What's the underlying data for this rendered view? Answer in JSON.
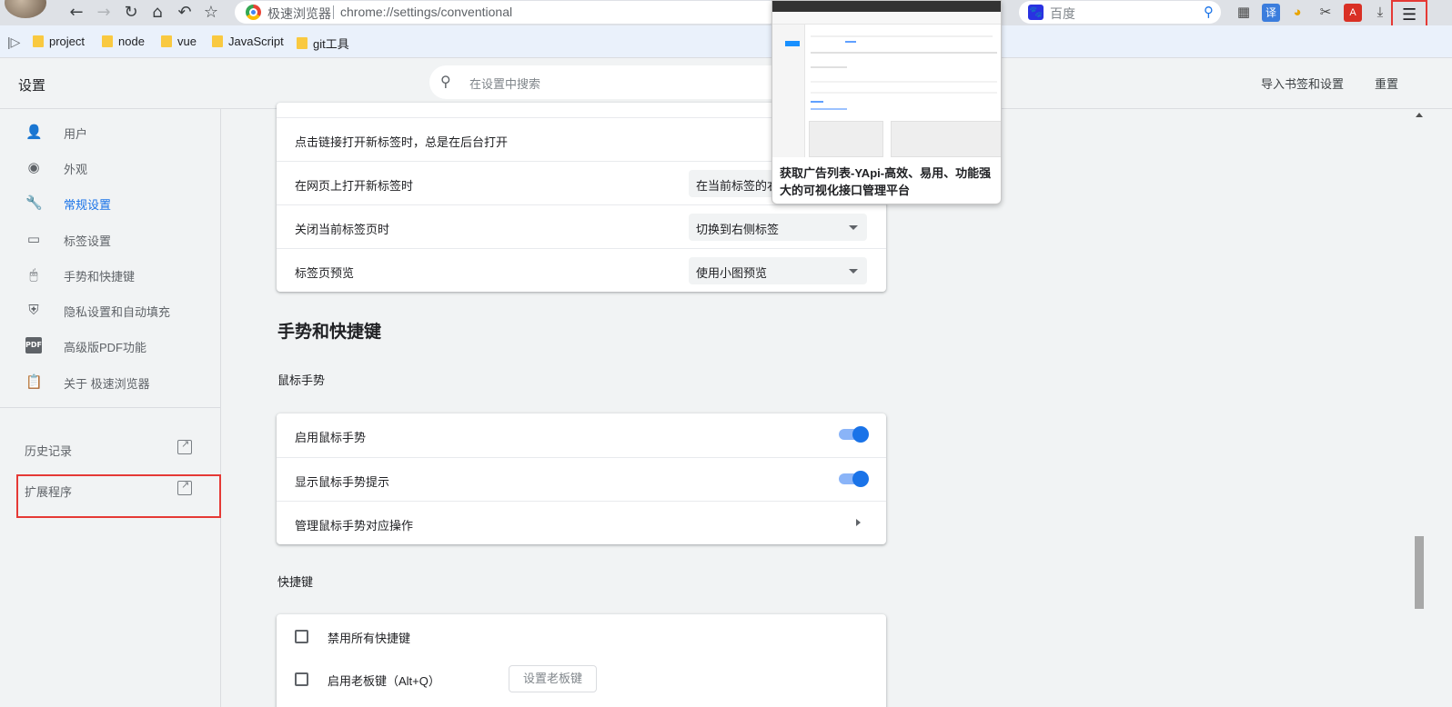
{
  "browser": {
    "name": "极速浏览器",
    "url": "chrome://settings/conventional",
    "search_placeholder": "百度",
    "bookmarks": [
      "project",
      "node",
      "vue",
      "JavaScript",
      "git工具"
    ]
  },
  "settings": {
    "title": "设置",
    "search_placeholder": "在设置中搜索",
    "import_label": "导入书签和设置",
    "reset_label": "重置"
  },
  "sidebar": {
    "items": [
      {
        "label": "用户",
        "icon": "person-icon"
      },
      {
        "label": "外观",
        "icon": "palette-icon"
      },
      {
        "label": "常规设置",
        "icon": "wrench-icon"
      },
      {
        "label": "标签设置",
        "icon": "tab-icon"
      },
      {
        "label": "手势和快捷键",
        "icon": "mouse-icon"
      },
      {
        "label": "隐私设置和自动填充",
        "icon": "shield-icon"
      },
      {
        "label": "高级版PDF功能",
        "icon": "pdf-icon"
      },
      {
        "label": "关于 极速浏览器",
        "icon": "clipboard-icon"
      }
    ],
    "active_index": 2,
    "links": [
      {
        "label": "历史记录"
      },
      {
        "label": "扩展程序"
      }
    ]
  },
  "tab_settings": {
    "rows": [
      {
        "label": "点击链接打开新标签时，总是在后台打开"
      },
      {
        "label": "在网页上打开新标签时",
        "value": "在当前标签的右侧"
      },
      {
        "label": "关闭当前标签页时",
        "value": "切换到右侧标签"
      },
      {
        "label": "标签页预览",
        "value": "使用小图预览"
      }
    ]
  },
  "gestures": {
    "heading": "手势和快捷键",
    "mouse_heading": "鼠标手势",
    "rows": [
      {
        "label": "启用鼠标手势",
        "enabled": true
      },
      {
        "label": "显示鼠标手势提示",
        "enabled": true
      },
      {
        "label": "管理鼠标手势对应操作"
      }
    ],
    "shortcut_heading": "快捷键",
    "shortcuts": [
      {
        "label": "禁用所有快捷键",
        "checked": false
      },
      {
        "label": "启用老板键（Alt+Q）",
        "checked": false,
        "button": "设置老板键"
      }
    ]
  },
  "preview": {
    "title": "获取广告列表-YApi-高效、易用、功能强大的可视化接口管理平台"
  },
  "colors": {
    "accent": "#1a73e8",
    "highlight_box": "#e53935"
  }
}
